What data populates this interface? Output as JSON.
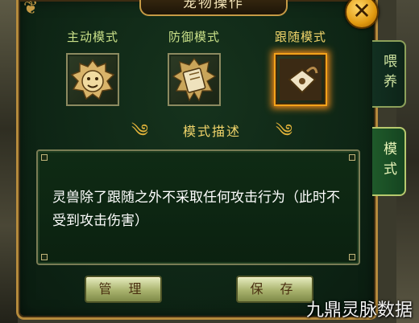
{
  "window": {
    "title": "宠物操作"
  },
  "modes": [
    {
      "label": "主动模式",
      "icon": "lion-face-icon",
      "selected": false
    },
    {
      "label": "防御模式",
      "icon": "shield-scroll-icon",
      "selected": false
    },
    {
      "label": "跟随模式",
      "icon": "pouch-bag-icon",
      "selected": true
    }
  ],
  "description": {
    "header": "模式描述",
    "text": "灵兽除了跟随之外不采取任何攻击行为（此时不受到攻击伤害）"
  },
  "buttons": {
    "manage": "管 理",
    "save": "保 存"
  },
  "tabs": [
    {
      "label": "喂养",
      "active": false
    },
    {
      "label": "模式",
      "active": true
    }
  ],
  "watermark": "九鼎灵脉数据",
  "colors": {
    "accent": "#f4a21a",
    "panel": "#0f2716",
    "button": "#a9b36e"
  }
}
